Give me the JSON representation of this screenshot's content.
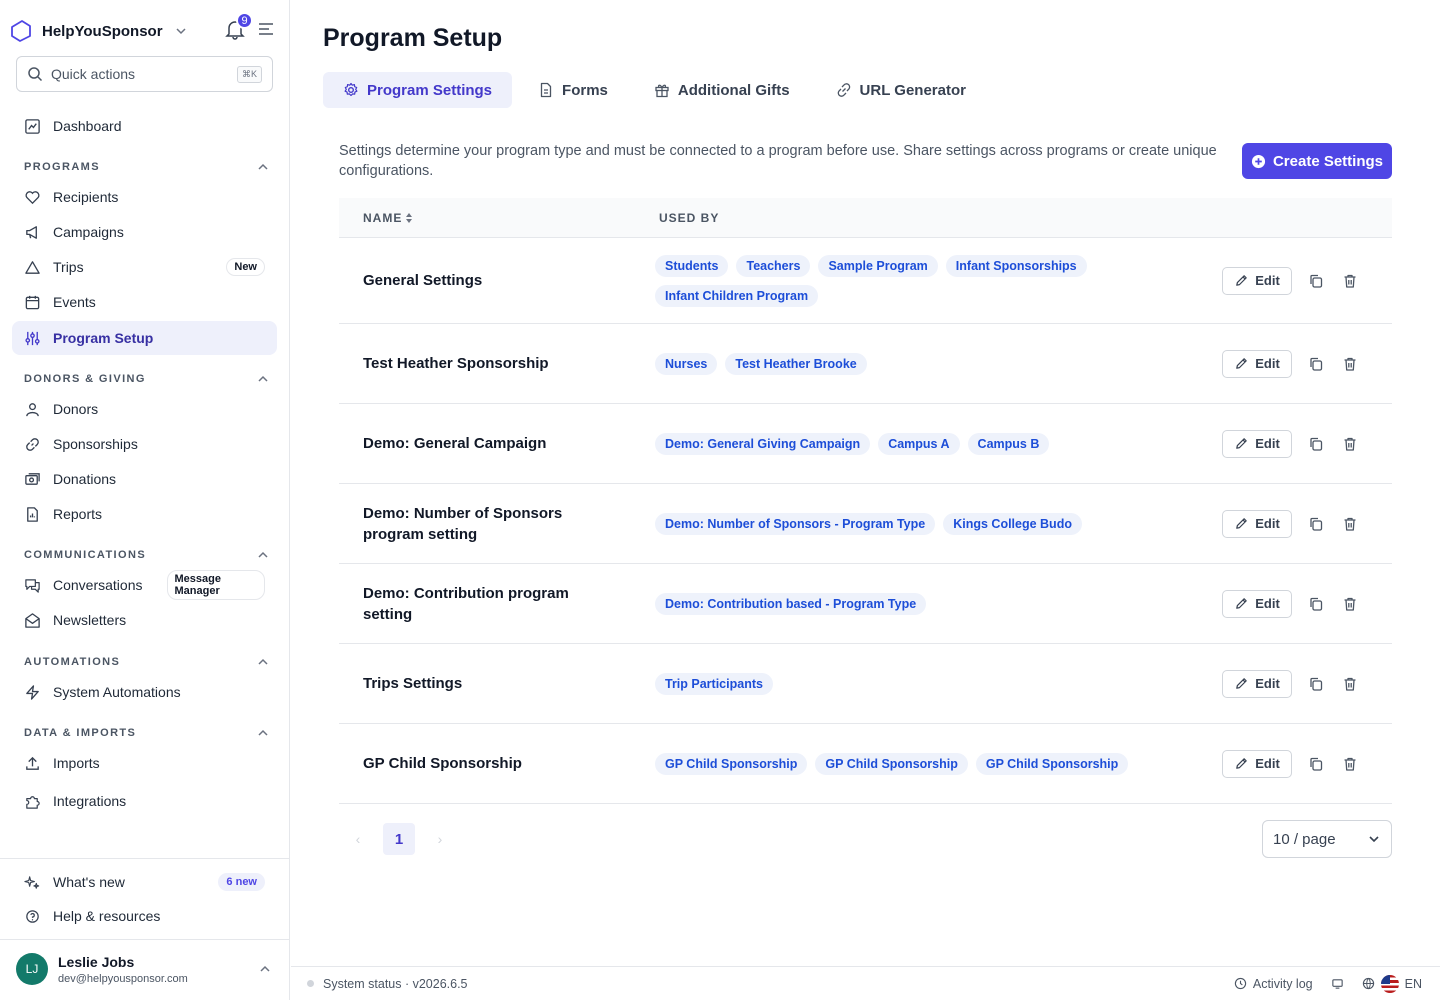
{
  "sidebar": {
    "brand": "HelpYouSponsor",
    "notifications_count": "9",
    "quick_actions": {
      "placeholder": "Quick actions",
      "shortcut": "⌘K"
    },
    "dashboard": "Dashboard",
    "sections": {
      "programs": "PROGRAMS",
      "donors": "DONORS & GIVING",
      "communications": "COMMUNICATIONS",
      "automations": "AUTOMATIONS",
      "data": "DATA & IMPORTS"
    },
    "items": {
      "recipients": "Recipients",
      "campaigns": "Campaigns",
      "trips": "Trips",
      "trips_badge": "New",
      "events": "Events",
      "program_setup": "Program Setup",
      "donors": "Donors",
      "sponsorships": "Sponsorships",
      "donations": "Donations",
      "reports": "Reports",
      "conversations": "Conversations",
      "conversations_badge": "Message Manager",
      "newsletters": "Newsletters",
      "system_automations": "System Automations",
      "imports": "Imports",
      "integrations": "Integrations"
    },
    "whats_new": "What's new",
    "whats_new_badge": "6 new",
    "help": "Help & resources",
    "user": {
      "initials": "LJ",
      "name": "Leslie Jobs",
      "email": "dev@helpyousponsor.com"
    }
  },
  "main": {
    "title": "Program Setup",
    "tabs": [
      "Program Settings",
      "Forms",
      "Additional Gifts",
      "URL Generator"
    ],
    "description": "Settings determine your program type and must be connected to a program before use. Share settings across programs or create unique configurations.",
    "create_button": "Create Settings",
    "table": {
      "headers": {
        "name": "NAME",
        "used_by": "USED BY"
      },
      "edit_label": "Edit",
      "rows": [
        {
          "name": "General Settings",
          "tags": [
            "Students",
            "Teachers",
            "Sample Program",
            "Infant Sponsorships",
            "Infant Children Program"
          ]
        },
        {
          "name": "Test Heather Sponsorship",
          "tags": [
            "Nurses",
            "Test Heather Brooke"
          ]
        },
        {
          "name": "Demo: General Campaign",
          "tags": [
            "Demo: General Giving Campaign",
            "Campus A",
            "Campus B"
          ]
        },
        {
          "name": "Demo: Number of Sponsors program setting",
          "tags": [
            "Demo: Number of Sponsors - Program Type",
            "Kings College Budo"
          ]
        },
        {
          "name": "Demo: Contribution program setting",
          "tags": [
            "Demo: Contribution based - Program Type"
          ]
        },
        {
          "name": "Trips Settings",
          "tags": [
            "Trip Participants"
          ]
        },
        {
          "name": "GP Child Sponsorship",
          "tags": [
            "GP Child Sponsorship",
            "GP Child Sponsorship",
            "GP Child Sponsorship"
          ]
        }
      ]
    },
    "pagination": {
      "current_page": "1",
      "page_size": "10 / page"
    }
  },
  "footer": {
    "status": "System status · v2026.6.5",
    "activity_log": "Activity log",
    "language": "EN"
  },
  "colors": {
    "accent": "#4f46e5",
    "tag_bg": "#eef2fb",
    "tag_text": "#1d4ed8",
    "avatar": "#137a6a"
  }
}
